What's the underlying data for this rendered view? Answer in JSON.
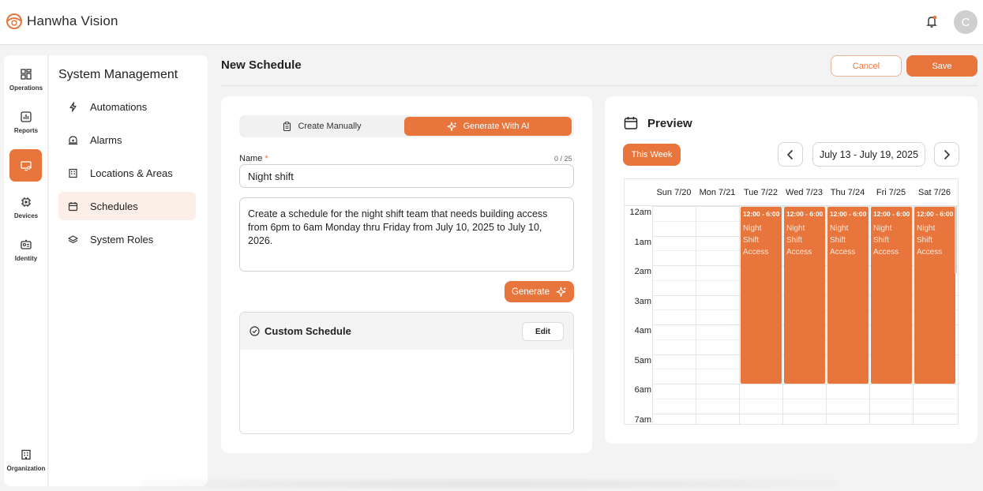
{
  "app": {
    "brand": "Hanwha Vision",
    "avatar_initial": "C",
    "accent": "#e8763c"
  },
  "rail": {
    "items": [
      {
        "label": "Operations",
        "icon": "grid-icon"
      },
      {
        "label": "Reports",
        "icon": "bar-chart-icon"
      },
      {
        "label": "",
        "icon": "monitor-settings-icon",
        "active": true
      },
      {
        "label": "Devices",
        "icon": "chip-icon"
      },
      {
        "label": "Identity",
        "icon": "id-card-icon"
      },
      {
        "label": "Organization",
        "icon": "building-icon"
      }
    ]
  },
  "sidebar": {
    "title": "System Management",
    "items": [
      {
        "label": "Automations",
        "icon": "lightning-icon"
      },
      {
        "label": "Alarms",
        "icon": "siren-icon"
      },
      {
        "label": "Locations & Areas",
        "icon": "building-icon"
      },
      {
        "label": "Schedules",
        "icon": "calendar-icon",
        "active": true
      },
      {
        "label": "System Roles",
        "icon": "layers-icon"
      }
    ]
  },
  "header": {
    "title": "New Schedule",
    "cancel_label": "Cancel",
    "save_label": "Save"
  },
  "form": {
    "mode_manual": "Create Manually",
    "mode_ai": "Generate With AI",
    "name_label": "Name",
    "required_mark": "*",
    "name_count": "0 / 25",
    "name_value": "Night shift",
    "prompt_text": "Create a schedule for the night shift team that needs building access from 6pm to 6am Monday thru Friday from July 10, 2025 to July 10, 2026.",
    "generate_label": "Generate",
    "custom_title": "Custom Schedule",
    "edit_label": "Edit"
  },
  "preview": {
    "title": "Preview",
    "this_week_label": "This Week",
    "date_range": "July 13 - July 19, 2025",
    "days": [
      "Sun 7/20",
      "Mon 7/21",
      "Tue 7/22",
      "Wed 7/23",
      "Thu 7/24",
      "Fri 7/25",
      "Sat 7/26"
    ],
    "hours": [
      "12am",
      "1am",
      "2am",
      "3am",
      "4am",
      "5am",
      "6am",
      "7am"
    ],
    "events": [
      {
        "day_index": 2,
        "time": "12:00 - 6:00",
        "title": "Night Shift Access"
      },
      {
        "day_index": 3,
        "time": "12:00 - 6:00",
        "title": "Night Shift Access"
      },
      {
        "day_index": 4,
        "time": "12:00 - 6:00",
        "title": "Night Shift Access"
      },
      {
        "day_index": 5,
        "time": "12:00 - 6:00",
        "title": "Night Shift Access"
      },
      {
        "day_index": 6,
        "time": "12:00 - 6:00",
        "title": "Night Shift Access"
      }
    ]
  }
}
